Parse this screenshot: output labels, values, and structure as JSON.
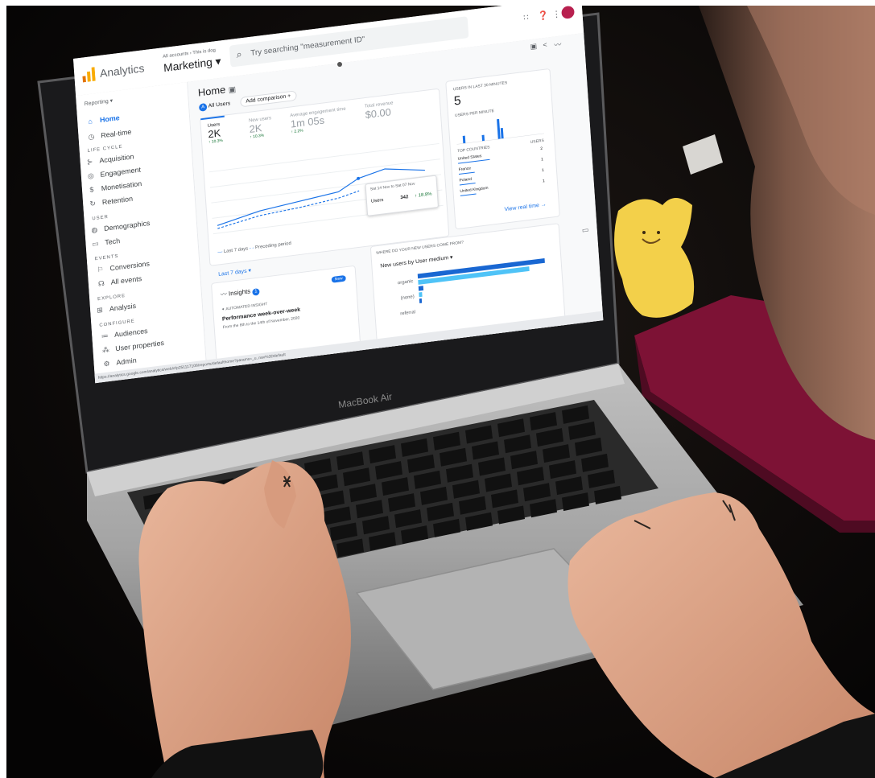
{
  "laptop": {
    "brand_label": "MacBook Air"
  },
  "analytics": {
    "product_name": "Analytics",
    "breadcrumb": "All accounts › This is dog",
    "property_name": "Marketing ▾",
    "search_placeholder": "Try searching \"measurement ID\"",
    "reporting_label": "Reporting ▾",
    "nav": {
      "home": "Home",
      "realtime": "Real-time",
      "lifecycle_header": "LIFE CYCLE",
      "acquisition": "Acquisition",
      "engagement": "Engagement",
      "monetisation": "Monetisation",
      "retention": "Retention",
      "user_header": "USER",
      "demographics": "Demographics",
      "tech": "Tech",
      "events_header": "EVENTS",
      "conversions": "Conversions",
      "all_events": "All events",
      "explore_header": "EXPLORE",
      "analysis": "Analysis",
      "configure_header": "CONFIGURE",
      "audiences": "Audiences",
      "user_properties": "User properties",
      "admin": "Admin"
    },
    "page_title": "Home",
    "comparison_chip": "All Users",
    "add_comparison": "Add comparison +",
    "metrics": [
      {
        "label": "Users",
        "value": "2K",
        "delta": "↑ 10.3%"
      },
      {
        "label": "New users",
        "value": "2K",
        "delta": "↑ 10.3%"
      },
      {
        "label": "Average engagement time",
        "value": "1m 05s",
        "delta": "↑ 2.2%"
      },
      {
        "label": "Total revenue",
        "value": "$0.00",
        "delta": ""
      }
    ],
    "tooltip": {
      "range": "Sat 14 Nov to Sat 07 Nov",
      "metric": "Users",
      "value": "342",
      "delta": "↑ 18.8%"
    },
    "legend": {
      "current": "Last 7 days",
      "previous": "Preceding period"
    },
    "date_range": "Last 7 days ▾",
    "realtime_card": {
      "title": "USERS IN LAST 30 MINUTES",
      "value": "5",
      "per_minute": "USERS PER MINUTE",
      "top_countries_header": "TOP COUNTRIES",
      "users_header": "USERS",
      "countries": [
        {
          "name": "United States",
          "value": "2"
        },
        {
          "name": "France",
          "value": "1"
        },
        {
          "name": "Poland",
          "value": "1"
        },
        {
          "name": "United Kingdom",
          "value": "1"
        }
      ],
      "view_link": "View real time →"
    },
    "insights": {
      "title": "Insights",
      "count": "1",
      "badge": "New",
      "tag": "AUTOMATED INSIGHT",
      "headline": "Performance week-over-week",
      "sub": "From the 8th to the 14th of November, 2020"
    },
    "acquisition_card": {
      "question": "WHERE DO YOUR NEW USERS COME FROM?",
      "selector": "New users by User medium ▾",
      "rows": [
        "organic",
        "(none)",
        "referral"
      ]
    },
    "status_url": "https://analytics.google.com/analytics/web/#/p251117108/reports/defaulthome?params=_u..nav%3Ddefault"
  }
}
